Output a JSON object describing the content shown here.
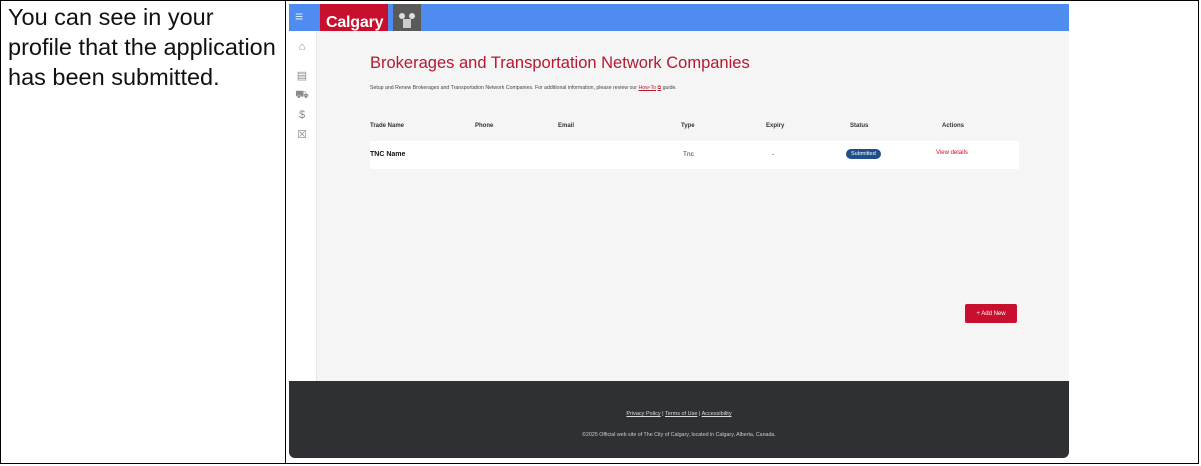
{
  "instruction": "You can see in your profile that the application has been submitted.",
  "app": {
    "logo_text": "Calgary",
    "crest_icon": "city-crest-icon",
    "menu_icon": "≡"
  },
  "sidenav": {
    "icons": [
      "⌂",
      "▤",
      "⛟",
      "$",
      "☒"
    ]
  },
  "page": {
    "title": "Brokerages and Transportation Network Companies",
    "desc_before": "Setup and Renew Brokerages and Transportation Network Companies. For additional information, please review our ",
    "desc_link": "How-To",
    "desc_link_icon": "⧉",
    "desc_after": " guide."
  },
  "table": {
    "headers": [
      "Trade Name",
      "Phone",
      "Email",
      "Type",
      "Expiry",
      "Status",
      "Actions"
    ],
    "rows": [
      {
        "trade_name": "TNC Name",
        "phone": "",
        "email": "",
        "type": "Tnc",
        "expiry": "-",
        "status": "Submitted",
        "action": "View details"
      }
    ]
  },
  "add_button": "+ Add New",
  "footer": {
    "privacy": "Privacy Policy",
    "sep1": " | ",
    "terms": "Terms of Use",
    "sep2": " | ",
    "accessibility": "Accessibility",
    "copyright": "©2025 Official web site of The City of Calgary, located in Calgary, Alberta, Canada."
  },
  "colors": {
    "brand_red": "#c8102e",
    "topbar_blue": "#4e8cf0",
    "status_blue": "#1f4e8c",
    "footer_dark": "#2f3033"
  }
}
